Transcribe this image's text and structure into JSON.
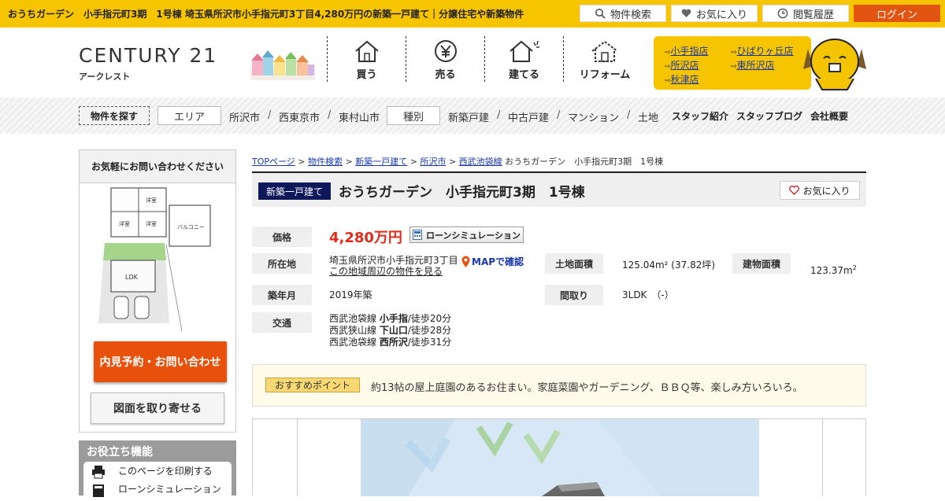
{
  "topbar": {
    "page_title": "おうちガーデン　小手指元町3期　1号棟 埼玉県所沢市小手指元町3丁目4,280万円の新築一戸建て｜分譲住宅や新築物件｜株式会...",
    "search_label": "物件検索",
    "favorites_label": "お気に入り",
    "history_label": "閲覧履歴",
    "login_label": "ログイン"
  },
  "header": {
    "logo_main": "CENTURY 21",
    "logo_sub": "アークレスト",
    "nav": [
      {
        "label": "買う",
        "icon": "house-buy-icon"
      },
      {
        "label": "売る",
        "icon": "yen-sell-icon"
      },
      {
        "label": "建てる",
        "icon": "house-build-icon"
      },
      {
        "label": "リフォーム",
        "icon": "house-reform-icon"
      }
    ],
    "stores": [
      "小手指店",
      "ひばりヶ丘店",
      "所沢店",
      "東所沢店",
      "秋津店"
    ]
  },
  "category_bar": {
    "find_label": "物件を探す",
    "area_label": "エリア",
    "areas": [
      "所沢市",
      "西東京市",
      "東村山市"
    ],
    "type_label": "種別",
    "types": [
      "新築戸建",
      "中古戸建",
      "マンション",
      "土地"
    ],
    "links": [
      "スタッフ紹介",
      "スタッフブログ",
      "会社概要"
    ],
    "separator": "/"
  },
  "sidebar": {
    "contact_heading": "お気軽にお問い合わせください",
    "reserve_button": "内見予約・お問い合わせ",
    "plan_button": "図面を取り寄せる",
    "useful_title": "お役立ち機能",
    "useful_items": [
      "このページを印刷する",
      "ローンシミュレーション"
    ]
  },
  "breadcrumb": {
    "items": [
      "TOPページ",
      "物件検索",
      "新築一戸建て",
      "所沢市",
      "西武池袋線"
    ],
    "current": "おうちガーデン　小手指元町3期　1号棟",
    "separator": ">"
  },
  "property": {
    "badge": "新築一戸建て",
    "title": "おうちガーデン　小手指元町3期　1号棟",
    "favorite_label": "お気に入り",
    "price_label": "価格",
    "price": "4,280万円",
    "loan_button": "ローンシミュレーション",
    "address_label": "所在地",
    "address": "埼玉県所沢市小手指元町3丁目",
    "map_link": "MAPで確認",
    "nearby_link": "この地域周辺の物件を見る",
    "land_area_label": "土地面積",
    "land_area": "125.04m² (37.82坪)",
    "building_area_label": "建物面積",
    "building_area": "123.37m",
    "building_area_sup": "2",
    "built_label": "築年月",
    "built": "2019年築",
    "layout_label": "間取り",
    "layout": "3LDK　（-）",
    "transport_label": "交通",
    "transport": [
      {
        "line": "西武池袋線",
        "station": "小手指",
        "walk": "/徒歩20分"
      },
      {
        "line": "西武狭山線",
        "station": "下山口",
        "walk": "/徒歩28分"
      },
      {
        "line": "西武池袋線",
        "station": "西所沢",
        "walk": "/徒歩31分"
      }
    ]
  },
  "recommend": {
    "badge": "おすすめポイント",
    "text": "約13帖の屋上庭園のあるお住まい。家庭菜園やガーデニング、ＢＢＱ等、楽しみ方いろいろ。"
  },
  "floorplan": {
    "room_labels": [
      "洋室",
      "洋室",
      "洋室",
      "LDK",
      "バルコニー"
    ]
  },
  "colors": {
    "brand_yellow": "#f7c400",
    "login_orange": "#e15411",
    "price_red": "#e32b1b",
    "badge_navy": "#10185c",
    "cta_orange": "#e8510b"
  }
}
